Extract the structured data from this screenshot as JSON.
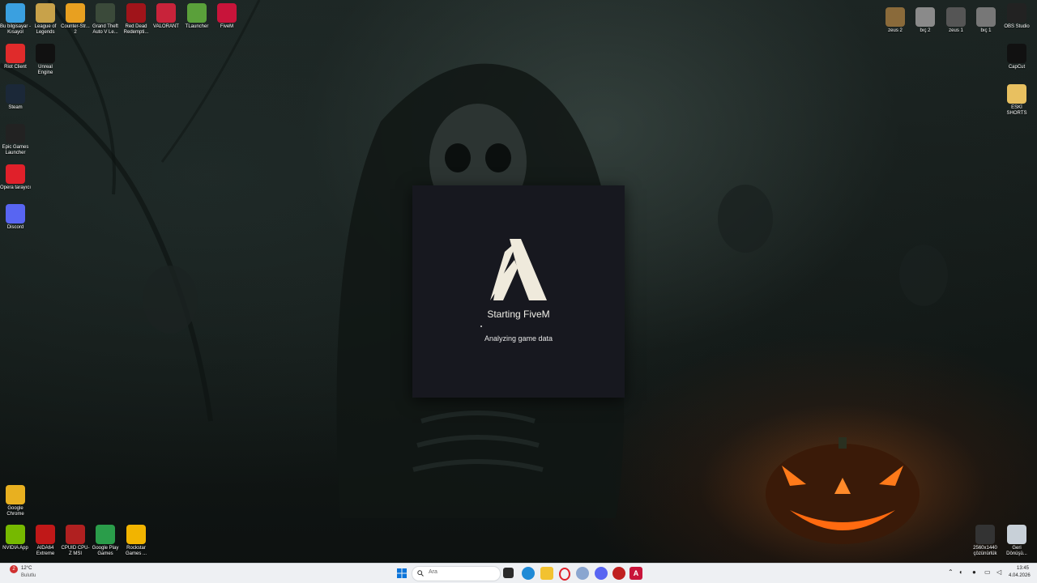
{
  "desktop": {
    "left_icons": [
      {
        "label": "Bu bilgisayar - Kısayol",
        "icon": "computer-icon",
        "color": "#3aa0e0"
      },
      {
        "label": "League of Legends",
        "icon": "league-of-legends-icon",
        "color": "#c8a24a"
      },
      {
        "label": "Counter-Str... 2",
        "icon": "counter-strike-icon",
        "color": "#e8a020"
      },
      {
        "label": "Grand Theft Auto V Le...",
        "icon": "gta-v-icon",
        "color": "#3b4a3a"
      },
      {
        "label": "Red Dead Redempti...",
        "icon": "red-dead-icon",
        "color": "#a0141a"
      },
      {
        "label": "VALORANT",
        "icon": "valorant-icon",
        "color": "#c8233a"
      },
      {
        "label": "TLauncher",
        "icon": "tlauncher-icon",
        "color": "#5aa03a"
      },
      {
        "label": "FiveM",
        "icon": "fivem-icon",
        "color": "#c8143a"
      },
      {
        "label": "Riot Client",
        "icon": "riot-client-icon",
        "color": "#e02b2b"
      },
      {
        "label": "Unreal Engine",
        "icon": "unreal-engine-icon",
        "color": "#111111"
      },
      {
        "label": "Steam",
        "icon": "steam-icon",
        "color": "#1b2838"
      },
      {
        "label": "Epic Games Launcher",
        "icon": "epic-games-icon",
        "color": "#222222"
      },
      {
        "label": "Opera tarayıcı",
        "icon": "opera-icon",
        "color": "#e0202a"
      },
      {
        "label": "Discord",
        "icon": "discord-icon",
        "color": "#5865f2"
      },
      {
        "label": "Google Chrome",
        "icon": "chrome-icon",
        "color": "#e8b020"
      },
      {
        "label": "NVIDIA App",
        "icon": "nvidia-icon",
        "color": "#76b900"
      },
      {
        "label": "AIDA64 Extreme",
        "icon": "aida64-icon",
        "color": "#c01818"
      },
      {
        "label": "CPUID CPU-Z MSI",
        "icon": "cpuz-icon",
        "color": "#b02020"
      },
      {
        "label": "Google Play Games",
        "icon": "google-play-games-icon",
        "color": "#2a9d4a"
      },
      {
        "label": "Rockstar Games ...",
        "icon": "rockstar-icon",
        "color": "#f2b400"
      }
    ],
    "right_icons": [
      {
        "label": "zeus 2",
        "icon": "video-thumb-icon",
        "color": "#8a6a3a"
      },
      {
        "label": "bıç 2",
        "icon": "video-thumb-icon",
        "color": "#8a8a8a"
      },
      {
        "label": "zeus 1",
        "icon": "video-thumb-icon",
        "color": "#555555"
      },
      {
        "label": "bıç 1",
        "icon": "video-thumb-icon",
        "color": "#777777"
      },
      {
        "label": "OBS Studio",
        "icon": "obs-icon",
        "color": "#222222"
      },
      {
        "label": "CapCut",
        "icon": "capcut-icon",
        "color": "#111111"
      },
      {
        "label": "ESKİ SHORTS",
        "icon": "folder-icon",
        "color": "#e8c060"
      },
      {
        "label": "2560x1440 çözünürlük",
        "icon": "shortcut-icon",
        "color": "#333333"
      },
      {
        "label": "Geri Dönüşü...",
        "icon": "recycle-bin-icon",
        "color": "#c8d0d8"
      }
    ]
  },
  "loader": {
    "title": "Starting FiveM",
    "status": "Analyzing game data"
  },
  "taskbar": {
    "weather_temp": "12°C",
    "weather_text": "Bulutlu",
    "search_placeholder": "Ara",
    "time": "13:45",
    "date": "4.04.2026"
  }
}
